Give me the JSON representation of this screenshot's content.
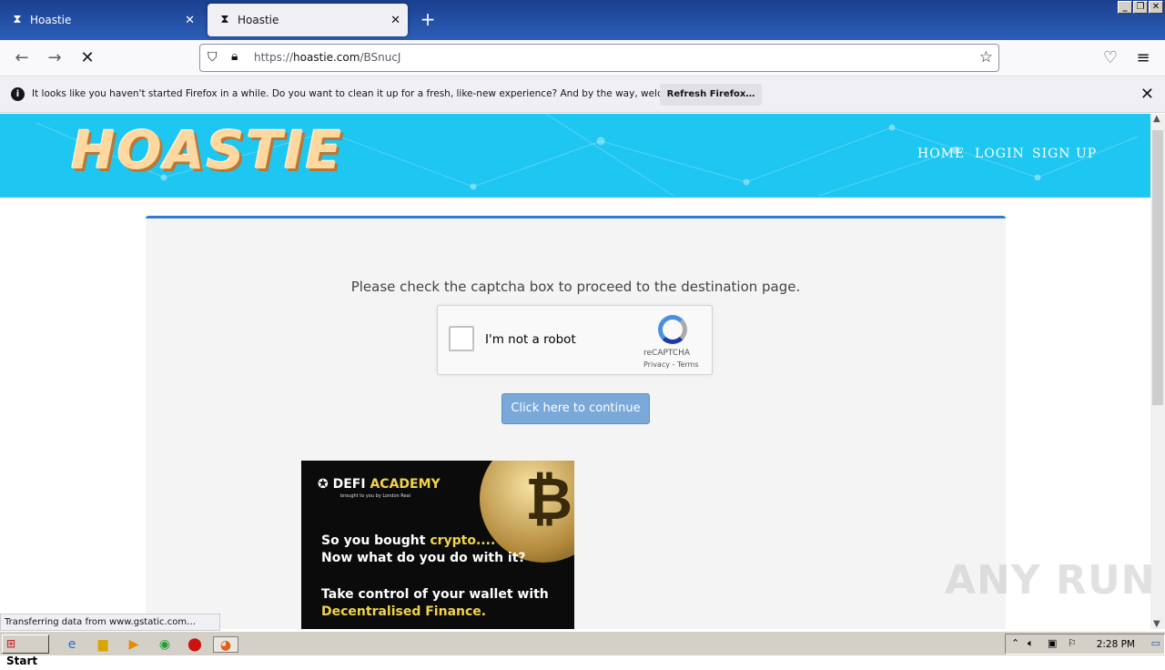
{
  "browser": {
    "tabs": [
      {
        "title": "Hoastie",
        "active": false
      },
      {
        "title": "Hoastie",
        "active": true
      }
    ],
    "url_prefix": "https://",
    "url_host": "hoastie.com",
    "url_path": "/BSnucJ",
    "notification": {
      "message": "It looks like you haven't started Firefox in a while. Do you want to clean it up for a fresh, like-new experience? And by the way, welcome back!",
      "button_label": "Refresh Firefox…"
    },
    "status_text": "Transferring data from www.gstatic.com…"
  },
  "site": {
    "logo": "HOASTIE",
    "nav": [
      "HOME",
      "LOGIN",
      "SIGN UP"
    ],
    "instruction": "Please check the captcha box to proceed to the destination page.",
    "captcha": {
      "label": "I'm not a robot",
      "brand": "reCAPTCHA",
      "links": "Privacy - Terms"
    },
    "continue_label": "Click here to continue",
    "ad": {
      "brand_a": "DEFI ",
      "brand_b": "ACADEMY",
      "sub": "brought to you by London Real",
      "line1_a": "So you bought ",
      "line1_b": "crypto....",
      "line2": "Now what do you do with it?",
      "line3": "Take control of your wallet with",
      "line4": "Decentralised Finance."
    },
    "colors": {
      "header_bg": "#1ec6f2",
      "accent": "#2e7bd6",
      "button": "#7aa8d9"
    }
  },
  "watermark": "ANY RUN",
  "taskbar": {
    "start_label": "Start",
    "clock": "2:28 PM"
  }
}
